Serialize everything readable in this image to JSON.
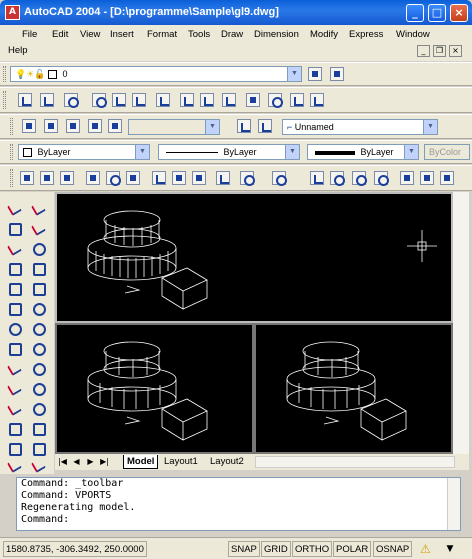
{
  "window": {
    "title": "AutoCAD 2004 - [D:\\programme\\Sample\\gl9.dwg]",
    "app_icon": "autocad-logo-icon",
    "controls": [
      "minimize-icon",
      "maximize-icon",
      "close-icon"
    ],
    "control_glyphs": [
      "_",
      "□",
      "×"
    ]
  },
  "menu": {
    "items": [
      "File",
      "Edit",
      "View",
      "Insert",
      "Format",
      "Tools",
      "Draw",
      "Dimension",
      "Modify",
      "Express",
      "Window",
      "Help"
    ],
    "mdi_glyphs": [
      "_",
      "❐",
      "×"
    ]
  },
  "layer_toolbar": {
    "layer_value": "0"
  },
  "properties": {
    "named_ucs": "Unnamed",
    "color": "ByLayer",
    "linetype": "ByLayer",
    "lineweight": "ByLayer",
    "plot_style": "ByColor"
  },
  "layout_tabs": {
    "nav_glyphs": [
      "|◀",
      "◀",
      "▶",
      "▶|"
    ],
    "tabs": [
      "Model",
      "Layout1",
      "Layout2"
    ],
    "active": "Model"
  },
  "command_window": {
    "lines": [
      "Command: _toolbar",
      "Command: VPORTS",
      "Regenerating model."
    ],
    "prompt": "Command:"
  },
  "status": {
    "coordinates": "1580.8735, -306.3492, 250.0000",
    "buttons": [
      "SNAP",
      "GRID",
      "ORTHO",
      "POLAR",
      "OSNAP"
    ]
  },
  "colors": {
    "titlebar": "#1559d0",
    "canvas": "#000000",
    "chrome": "#ece9d8"
  }
}
